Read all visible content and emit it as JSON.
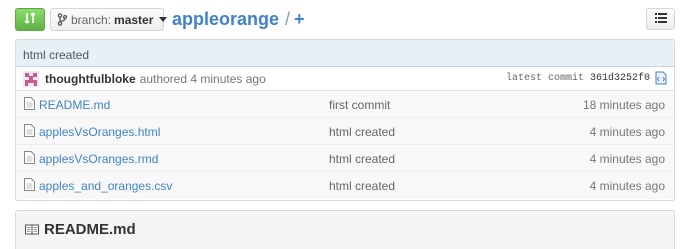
{
  "header": {
    "branch_prefix": "branch:",
    "branch_name": "master",
    "repo_name": "appleorange",
    "separator": "/",
    "add_label": "+"
  },
  "commit": {
    "title": "html created",
    "author": "thoughtfulbloke",
    "authored_text": "authored 4 minutes ago",
    "latest_label": "latest commit",
    "sha": "361d3252f0"
  },
  "files": [
    {
      "name": "README.md",
      "message": "first commit",
      "age": "18 minutes ago"
    },
    {
      "name": "applesVsOranges.html",
      "message": "html created",
      "age": "4 minutes ago"
    },
    {
      "name": "applesVsOranges.rmd",
      "message": "html created",
      "age": "4 minutes ago"
    },
    {
      "name": "apples_and_oranges.csv",
      "message": "html created",
      "age": "4 minutes ago"
    }
  ],
  "readme": {
    "title": "README.md"
  },
  "icons": {
    "compare": "compare-icon",
    "branch": "branch-icon",
    "list": "list-icon",
    "file": "file-icon",
    "browse": "browse-code-icon",
    "book": "book-icon"
  },
  "colors": {
    "accent_green": "#60b044",
    "link_blue": "#4183c4",
    "commit_bar": "#e6f1f6"
  }
}
